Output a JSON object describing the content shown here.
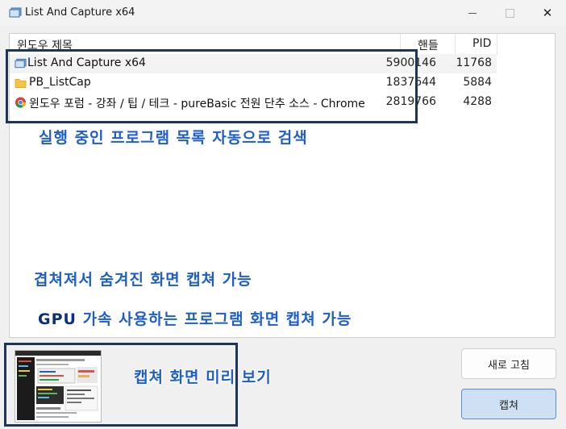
{
  "window": {
    "title": "List And Capture x64",
    "close_glyph": "✕"
  },
  "table": {
    "columns": {
      "title": "윈도우 제목",
      "handle": "핸들",
      "pid": "PID"
    },
    "rows": [
      {
        "icon": "app-icon",
        "title": "List And Capture x64",
        "handle": "5900146",
        "pid": "11768"
      },
      {
        "icon": "folder-icon",
        "title": "PB_ListCap",
        "handle": "1837644",
        "pid": "5884"
      },
      {
        "icon": "chrome-icon",
        "title": "윈도우 포럼 - 강좌 / 팁 / 테크 - pureBasic 전원 단추 소스 - Chrome",
        "handle": "2819766",
        "pid": "4288"
      }
    ]
  },
  "annotations": {
    "list_note": "실행 중인 프로그램 목록 자동으로 검색",
    "overlap_note": "겹쳐져서 숨겨진 화면 캡쳐 가능",
    "gpu_note_bold": "GPU",
    "gpu_note_rest": " 가속 사용하는 프로그램 화면 캡쳐 가능",
    "preview_note": "캡쳐 화면 미리 보기",
    "box_color": "#1d3557",
    "text_color": "#1f5fc4"
  },
  "buttons": {
    "refresh": "새로 고침",
    "capture": "캡쳐"
  }
}
